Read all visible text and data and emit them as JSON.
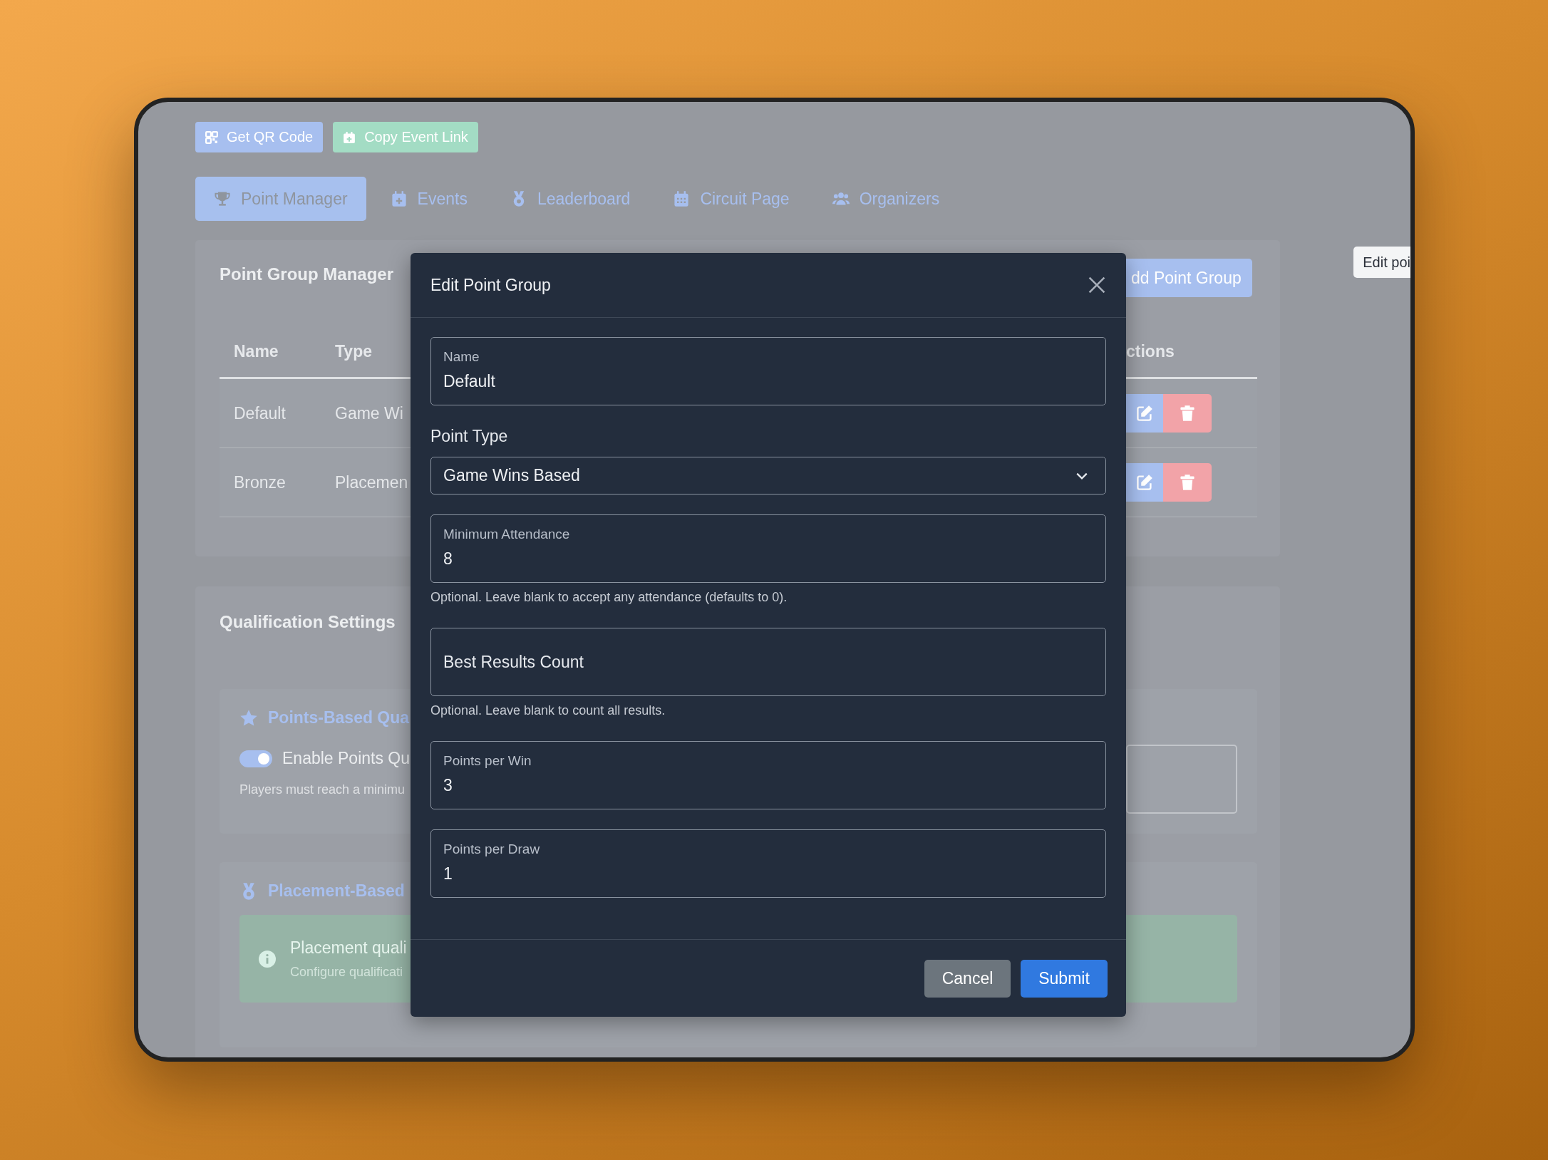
{
  "toolbar_buttons": [
    {
      "label": "Get QR Code",
      "kind": "qr"
    },
    {
      "label": "Copy Event Link",
      "kind": "link"
    }
  ],
  "tabs": [
    {
      "label": "Point Manager",
      "selected": true
    },
    {
      "label": "Events",
      "selected": false
    },
    {
      "label": "Leaderboard",
      "selected": false
    },
    {
      "label": "Circuit Page",
      "selected": false
    },
    {
      "label": "Organizers",
      "selected": false
    }
  ],
  "point_group_manager": {
    "title": "Point Group Manager",
    "add_button": "dd Point Group",
    "table": {
      "columns": [
        "Name",
        "Type",
        "ctions"
      ],
      "rows": [
        {
          "name": "Default",
          "type": "Game Wi"
        },
        {
          "name": "Bronze",
          "type": "Placemen"
        }
      ]
    }
  },
  "qualification_settings": {
    "title": "Qualification Settings",
    "points_based": {
      "title": "Points-Based Qua",
      "toggle": {
        "label": "Enable Points Qu",
        "on": true
      },
      "description": "Players must reach a minimu"
    },
    "placement_based": {
      "title": "Placement-Based",
      "alert": {
        "title": "Placement quali",
        "text": "Configure qualificati"
      }
    }
  },
  "tooltip": "Edit poi",
  "modal": {
    "title": "Edit Point Group",
    "fields": [
      {
        "kind": "floating",
        "label": "Name",
        "value": "Default"
      },
      {
        "kind": "select",
        "label": "Point Type",
        "value": "Game Wins Based"
      },
      {
        "kind": "floating",
        "label": "Minimum Attendance",
        "value": "8",
        "help": "Optional. Leave blank to accept any attendance (defaults to 0)."
      },
      {
        "kind": "placeholder",
        "placeholder": "Best Results Count",
        "help": "Optional. Leave blank to count all results."
      },
      {
        "kind": "floating",
        "label": "Points per Win",
        "value": "3"
      },
      {
        "kind": "floating",
        "label": "Points per Draw",
        "value": "1"
      }
    ],
    "buttons": [
      {
        "label": "Cancel",
        "kind": "secondary"
      },
      {
        "label": "Submit",
        "kind": "primary"
      }
    ]
  }
}
